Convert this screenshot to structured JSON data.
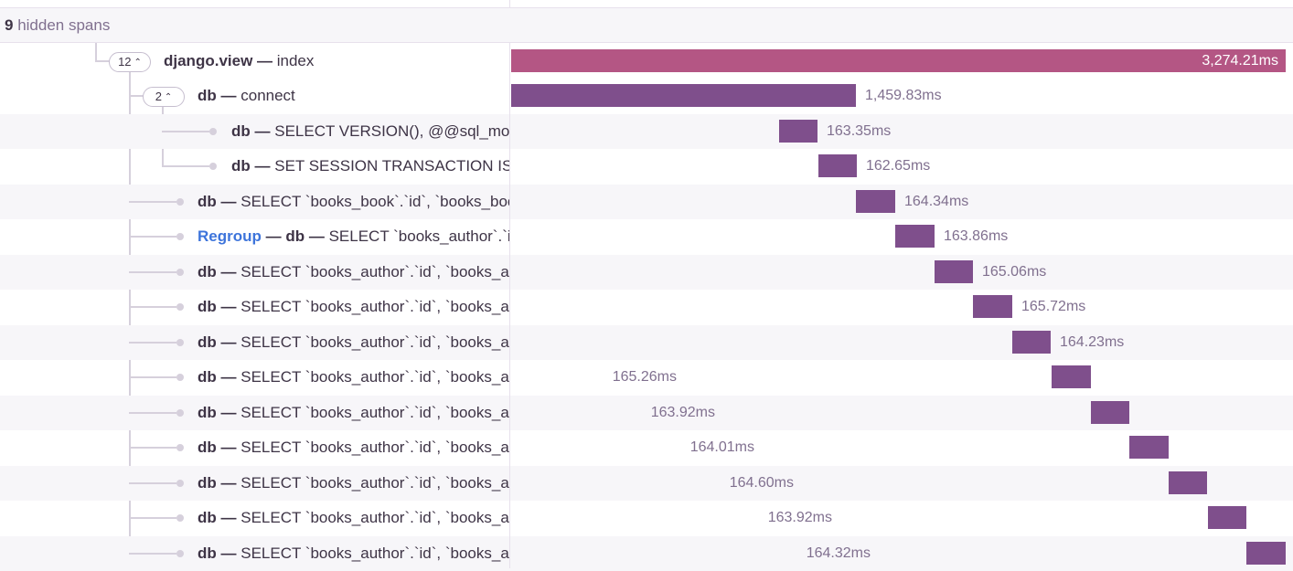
{
  "hidden_spans": {
    "count": "9",
    "text": "hidden spans"
  },
  "colors": {
    "root_bar": "#b45684",
    "child_bar": "#7f4f8c",
    "link": "#3d74db"
  },
  "root": {
    "op": "django.view",
    "sep": " — ",
    "desc": "index",
    "children_count": "12",
    "duration": "3,274.21ms"
  },
  "connect": {
    "op": "db",
    "sep": " — ",
    "desc": "connect",
    "children_count": "2",
    "duration": "1,459.83ms"
  },
  "spans": [
    {
      "op": "db",
      "desc": "SELECT VERSION(), @@sql_mode",
      "duration": "163.35ms"
    },
    {
      "op": "db",
      "desc": "SET SESSION TRANSACTION ISOLATION LEVEL READ COMMITTED",
      "duration": "162.65ms"
    },
    {
      "op": "db",
      "desc": "SELECT `books_book`.`id`, `books_book`.`title`",
      "duration": "164.34ms"
    },
    {
      "regroup": "Regroup",
      "op": "db",
      "desc": "SELECT `books_author`.`id`",
      "duration": "163.86ms"
    },
    {
      "op": "db",
      "desc": "SELECT `books_author`.`id`, `books_author`.`name`",
      "duration": "165.06ms"
    },
    {
      "op": "db",
      "desc": "SELECT `books_author`.`id`, `books_author`.`name`",
      "duration": "165.72ms"
    },
    {
      "op": "db",
      "desc": "SELECT `books_author`.`id`, `books_author`.`name`",
      "duration": "164.23ms"
    },
    {
      "op": "db",
      "desc": "SELECT `books_author`.`id`, `books_author`.`name`",
      "duration": "165.26ms"
    },
    {
      "op": "db",
      "desc": "SELECT `books_author`.`id`, `books_author`.`name`",
      "duration": "163.92ms"
    },
    {
      "op": "db",
      "desc": "SELECT `books_author`.`id`, `books_author`.`name`",
      "duration": "164.01ms"
    },
    {
      "op": "db",
      "desc": "SELECT `books_author`.`id`, `books_author`.`name`",
      "duration": "164.60ms"
    },
    {
      "op": "db",
      "desc": "SELECT `books_author`.`id`, `books_author`.`name`",
      "duration": "163.92ms"
    },
    {
      "op": "db",
      "desc": "SELECT `books_author`.`id`, `books_author`.`name`",
      "duration": "164.32ms"
    }
  ]
}
